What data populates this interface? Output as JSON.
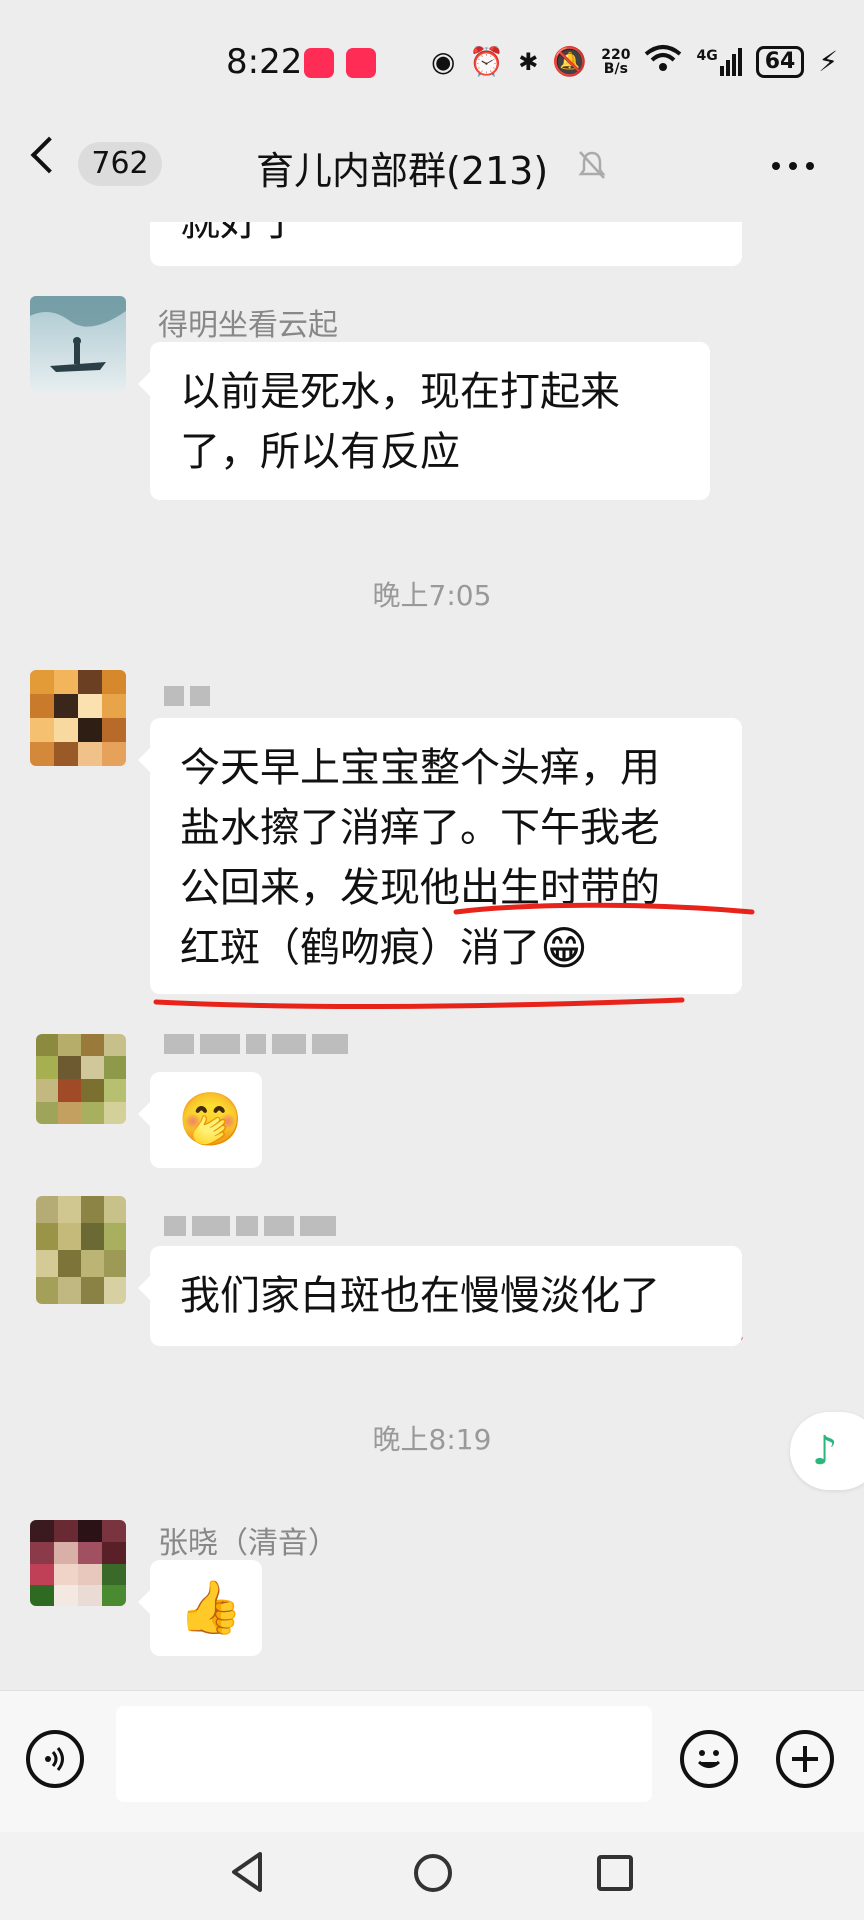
{
  "status_bar": {
    "time": "8:22",
    "net_speed_value": "220",
    "net_speed_unit": "B/s",
    "network": "4G",
    "battery": "64"
  },
  "header": {
    "unread_count": "762",
    "title": "育儿内部群(213)"
  },
  "messages": [
    {
      "type": "text",
      "text_line1": "就好了",
      "partial": true
    },
    {
      "type": "text",
      "sender": "得明坐看云起",
      "text_line1": "以前是死水，现在打起来",
      "text_line2": "了，所以有反应"
    },
    {
      "type": "timestamp",
      "text": "晚上7:05"
    },
    {
      "type": "text",
      "sender": "",
      "text_line1": "今天早上宝宝整个头痒，用",
      "text_line2": "盐水擦了消痒了。下午我老",
      "text_line3": "公回来，发现他出生时带的",
      "text_line4": "红斑（鹤吻痕）消了",
      "emoji": "😁"
    },
    {
      "type": "emoji",
      "sender": "",
      "emoji": "🤭"
    },
    {
      "type": "text",
      "sender": "",
      "text_line1": "我们家白斑也在慢慢淡化了"
    },
    {
      "type": "timestamp",
      "text": "晚上8:19"
    },
    {
      "type": "emoji",
      "sender": "张晓（清音）",
      "emoji": "👍"
    }
  ],
  "annotation_color": "#e8231a",
  "accent_color": "#2db67c"
}
